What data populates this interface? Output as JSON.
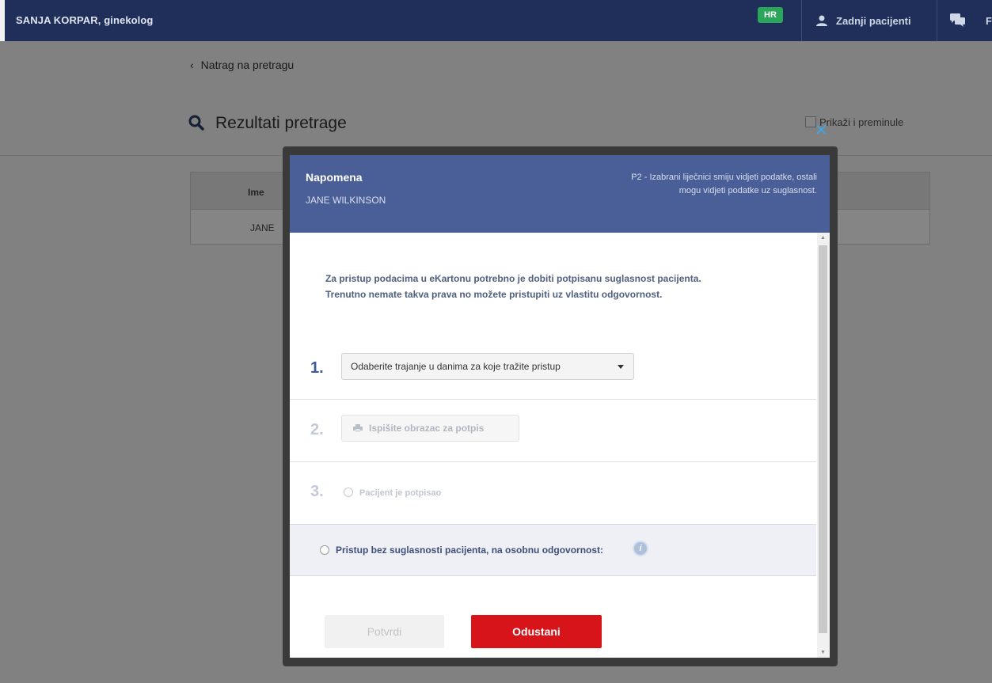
{
  "topbar": {
    "doctor": "SANJA KORPAR, ginekolog",
    "language": "HR",
    "recent_patients": "Zadnji pacijenti",
    "cut_label": "F"
  },
  "page": {
    "back": "Natrag na pretragu",
    "results_title": "Rezultati pretrage",
    "show_deceased": "Prikaži i preminule",
    "table": {
      "col_name": "Ime",
      "row_name": "JANE"
    }
  },
  "modal": {
    "title": "Napomena",
    "patient": "JANE WILKINSON",
    "note": "P2 - Izabrani liječnici smiju vidjeti podatke, ostali mogu vidjeti podatke uz suglasnost.",
    "info_line1": "Za pristup podacima u eKartonu potrebno je dobiti potpisanu suglasnost pacijenta.",
    "info_line2": "Trenutno nemate takva prava no možete pristupiti uz vlastitu odgovornost.",
    "step1_num": "1.",
    "step1_select": "Odaberite trajanje u danima za koje tražite pristup",
    "step2_num": "2.",
    "step2_button": "Ispišite obrazac za potpis",
    "step3_num": "3.",
    "step3_label": "Pacijent je potpisao",
    "no_consent_label": "Pristup bez suglasnosti pacijenta, na osobnu odgovornost:",
    "info_icon": "i",
    "confirm": "Potvrdi",
    "cancel": "Odustani"
  },
  "colors": {
    "topbar": "#1f2f5a",
    "modal_header": "#4a5e98",
    "cancel_button": "#d7141a",
    "language_badge": "#2aa65a"
  },
  "icons": {
    "search": "search-icon",
    "user": "user-icon",
    "chat": "chat-icon",
    "print": "print-icon",
    "close": "close-icon",
    "info": "info-icon"
  }
}
